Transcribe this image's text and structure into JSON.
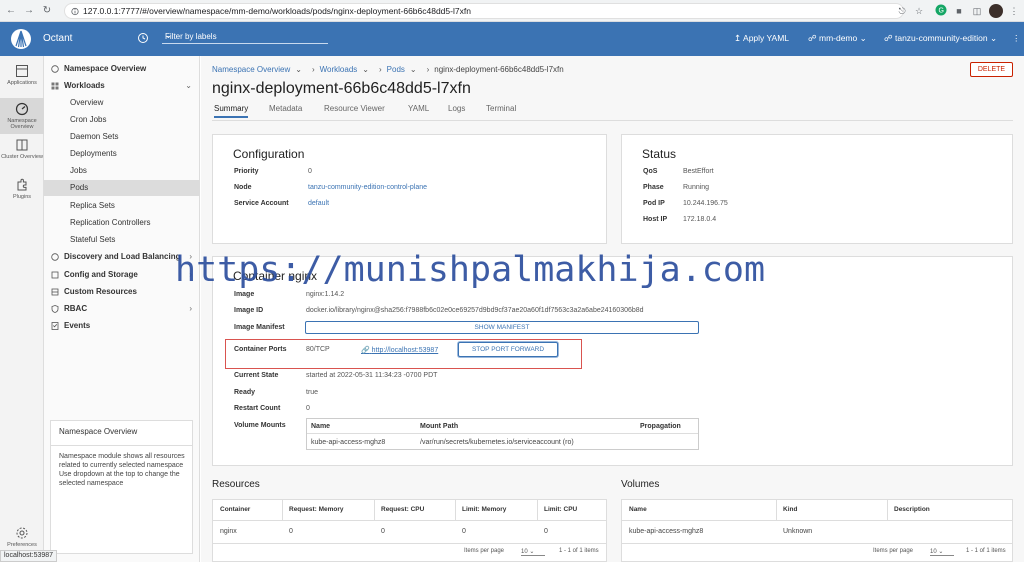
{
  "browser": {
    "url": "127.0.0.1:7777/#/overview/namespace/mm-demo/workloads/pods/nginx-deployment-66b6c48dd5-l7xfn",
    "status_url": "localhost:53987"
  },
  "header": {
    "app_name": "Octant",
    "filter_placeholder": "Filter by labels",
    "apply_yaml": "Apply YAML",
    "namespace": "mm-demo",
    "context": "tanzu-community-edition",
    "brand_color": "#3b73b3"
  },
  "rail": {
    "items": [
      {
        "label": "Applications",
        "icon": "applications-icon"
      },
      {
        "label": "Namespace Overview",
        "icon": "speedometer-icon"
      },
      {
        "label": "Cluster Overview",
        "icon": "cluster-icon"
      },
      {
        "label": "Plugins",
        "icon": "puzzle-icon"
      }
    ],
    "preferences_label": "Preferences"
  },
  "nav": {
    "items": [
      {
        "label": "Namespace Overview"
      },
      {
        "label": "Workloads"
      },
      {
        "label": "Overview"
      },
      {
        "label": "Cron Jobs"
      },
      {
        "label": "Daemon Sets"
      },
      {
        "label": "Deployments"
      },
      {
        "label": "Jobs"
      },
      {
        "label": "Pods"
      },
      {
        "label": "Replica Sets"
      },
      {
        "label": "Replication Controllers"
      },
      {
        "label": "Stateful Sets"
      },
      {
        "label": "Discovery and Load Balancing"
      },
      {
        "label": "Config and Storage"
      },
      {
        "label": "Custom Resources"
      },
      {
        "label": "RBAC"
      },
      {
        "label": "Events"
      }
    ],
    "info_title": "Namespace Overview",
    "info_text": "Namespace module shows all resources related to currently selected namespace Use dropdown at the top to change the selected namespace"
  },
  "breadcrumb": [
    "Namespace Overview",
    "Workloads",
    "Pods",
    "nginx-deployment-66b6c48dd5-l7xfn"
  ],
  "delete_label": "DELETE",
  "page_title": "nginx-deployment-66b6c48dd5-l7xfn",
  "tabs": [
    "Summary",
    "Metadata",
    "Resource Viewer",
    "YAML",
    "Logs",
    "Terminal"
  ],
  "configuration": {
    "title": "Configuration",
    "rows": [
      {
        "key": "Priority",
        "value": "0"
      },
      {
        "key": "Node",
        "value": "tanzu-community-edition-control-plane"
      },
      {
        "key": "Service Account",
        "value": "default"
      }
    ]
  },
  "status": {
    "title": "Status",
    "rows": [
      {
        "key": "QoS",
        "value": "BestEffort"
      },
      {
        "key": "Phase",
        "value": "Running"
      },
      {
        "key": "Pod IP",
        "value": "10.244.196.75"
      },
      {
        "key": "Host IP",
        "value": "172.18.0.4"
      }
    ]
  },
  "container": {
    "title": "Container nginx",
    "image_key": "Image",
    "image_value": "nginx:1.14.2",
    "image_id_key": "Image ID",
    "image_id_value": "docker.io/library/nginx@sha256:f7988fb6c02e0ce69257d9bd9cf37ae20a60f1df7563c3a2a6abe24160306b8d",
    "manifest_key": "Image Manifest",
    "show_manifest": "SHOW MANIFEST",
    "ports_key": "Container Ports",
    "ports_value": "80/TCP",
    "forward_link": "http://localhost:53987",
    "stop_forward": "STOP PORT FORWARD",
    "state_key": "Current State",
    "state_value": "started at 2022-05-31 11:34:23 -0700 PDT",
    "ready_key": "Ready",
    "ready_value": "true",
    "restart_key": "Restart Count",
    "restart_value": "0",
    "mounts_key": "Volume Mounts",
    "mounts_headers": [
      "Name",
      "Mount Path",
      "Propagation"
    ],
    "mounts_row": [
      "kube-api-access-mghz8",
      "/var/run/secrets/kubernetes.io/serviceaccount (ro)",
      ""
    ]
  },
  "resources": {
    "title": "Resources",
    "headers": [
      "Container",
      "Request: Memory",
      "Request: CPU",
      "Limit: Memory",
      "Limit: CPU"
    ],
    "row": [
      "nginx",
      "0",
      "0",
      "0",
      "0"
    ],
    "items_per_page_label": "Items per page",
    "items_per_page": "10",
    "range": "1 - 1 of 1 items"
  },
  "volumes": {
    "title": "Volumes",
    "headers": [
      "Name",
      "Kind",
      "Description"
    ],
    "row": [
      "kube-api-access-mghz8",
      "Unknown",
      ""
    ],
    "items_per_page_label": "Items per page",
    "items_per_page": "10",
    "range": "1 - 1 of 1 items"
  },
  "watermark": "https://munishpalmakhija.com"
}
